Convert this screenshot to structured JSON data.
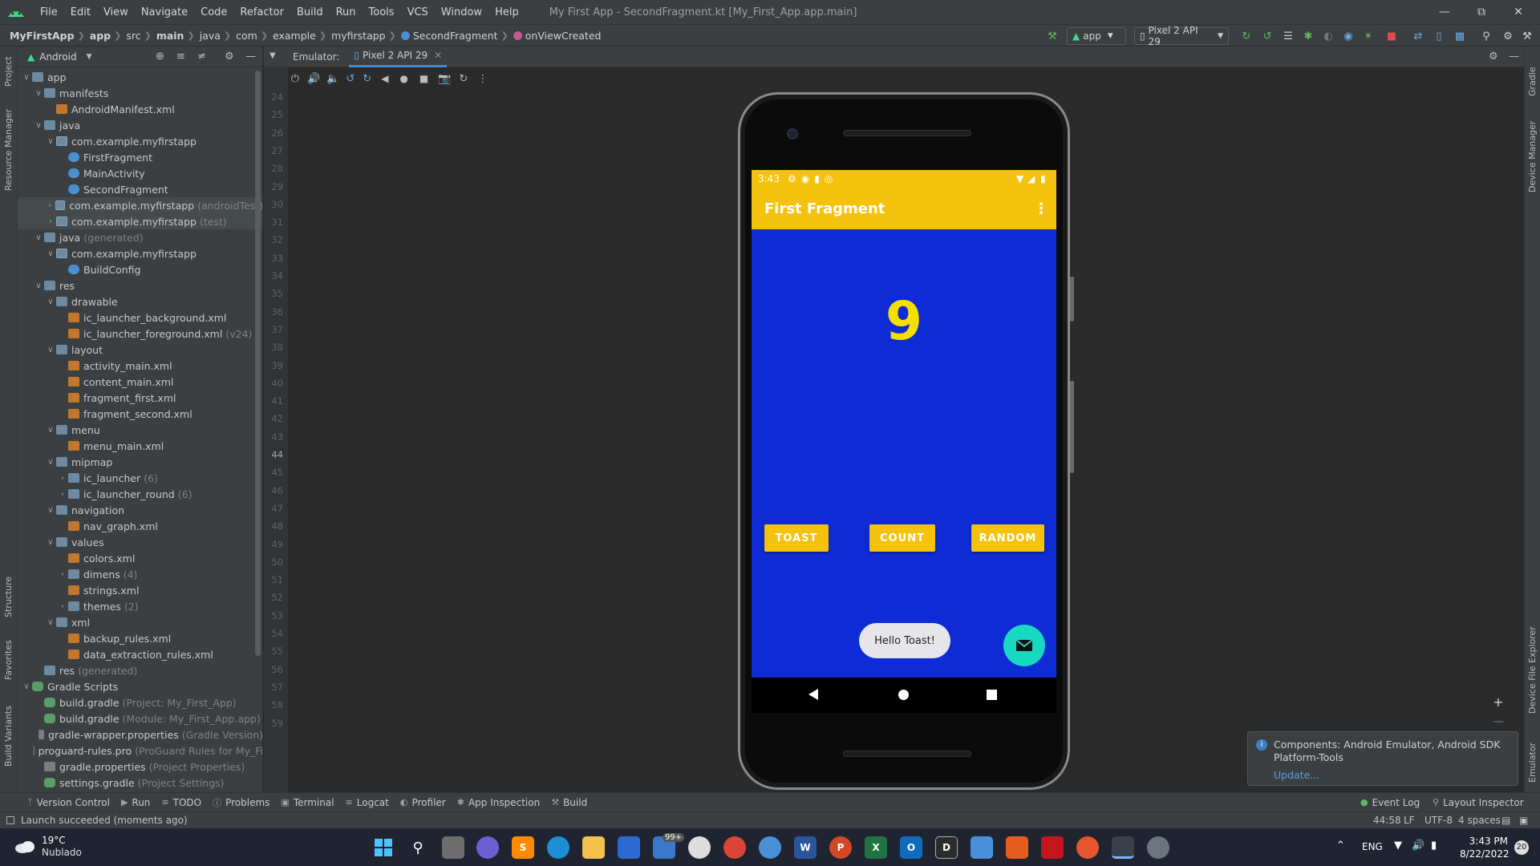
{
  "menubar": {
    "items": [
      "File",
      "Edit",
      "View",
      "Navigate",
      "Code",
      "Refactor",
      "Build",
      "Run",
      "Tools",
      "VCS",
      "Window",
      "Help"
    ],
    "title": "My First App - SecondFragment.kt [My_First_App.app.main]"
  },
  "breadcrumbs": {
    "items": [
      "MyFirstApp",
      "app",
      "src",
      "main",
      "java",
      "com",
      "example",
      "myfirstapp",
      "SecondFragment",
      "onViewCreated"
    ]
  },
  "toolbar": {
    "run_config": "app",
    "device": "Pixel 2 API 29"
  },
  "sidebar_left": {
    "tabs": [
      "Project",
      "Resource Manager",
      "Structure",
      "Favorites",
      "Build Variants"
    ]
  },
  "project": {
    "view": "Android",
    "tree": [
      {
        "label": "app",
        "sub": "",
        "icon": "folder",
        "arrow": "v"
      },
      {
        "label": "manifests",
        "sub": "",
        "icon": "folder",
        "arrow": "v"
      },
      {
        "label": "AndroidManifest.xml",
        "sub": "",
        "icon": "xml",
        "arrow": ""
      },
      {
        "label": "java",
        "sub": "",
        "icon": "folder",
        "arrow": "v"
      },
      {
        "label": "com.example.myfirstapp",
        "sub": "",
        "icon": "pkg",
        "arrow": "v"
      },
      {
        "label": "FirstFragment",
        "sub": "",
        "icon": "kt",
        "arrow": ""
      },
      {
        "label": "MainActivity",
        "sub": "",
        "icon": "kt",
        "arrow": ""
      },
      {
        "label": "SecondFragment",
        "sub": "",
        "icon": "kt",
        "arrow": ""
      },
      {
        "label": "com.example.myfirstapp",
        "sub": "(androidTest)",
        "icon": "pkg",
        "arrow": ">"
      },
      {
        "label": "com.example.myfirstapp",
        "sub": "(test)",
        "icon": "pkg",
        "arrow": ">"
      },
      {
        "label": "java",
        "sub": "(generated)",
        "icon": "folder",
        "arrow": "v"
      },
      {
        "label": "com.example.myfirstapp",
        "sub": "",
        "icon": "pkg",
        "arrow": "v"
      },
      {
        "label": "BuildConfig",
        "sub": "",
        "icon": "kt",
        "arrow": ""
      },
      {
        "label": "res",
        "sub": "",
        "icon": "folder",
        "arrow": "v"
      },
      {
        "label": "drawable",
        "sub": "",
        "icon": "folder",
        "arrow": "v"
      },
      {
        "label": "ic_launcher_background.xml",
        "sub": "",
        "icon": "xml",
        "arrow": ""
      },
      {
        "label": "ic_launcher_foreground.xml",
        "sub": "(v24)",
        "icon": "xml",
        "arrow": ""
      },
      {
        "label": "layout",
        "sub": "",
        "icon": "folder",
        "arrow": "v"
      },
      {
        "label": "activity_main.xml",
        "sub": "",
        "icon": "xml",
        "arrow": ""
      },
      {
        "label": "content_main.xml",
        "sub": "",
        "icon": "xml",
        "arrow": ""
      },
      {
        "label": "fragment_first.xml",
        "sub": "",
        "icon": "xml",
        "arrow": ""
      },
      {
        "label": "fragment_second.xml",
        "sub": "",
        "icon": "xml",
        "arrow": ""
      },
      {
        "label": "menu",
        "sub": "",
        "icon": "folder",
        "arrow": "v"
      },
      {
        "label": "menu_main.xml",
        "sub": "",
        "icon": "xml",
        "arrow": ""
      },
      {
        "label": "mipmap",
        "sub": "",
        "icon": "folder",
        "arrow": "v"
      },
      {
        "label": "ic_launcher",
        "sub": "(6)",
        "icon": "folder",
        "arrow": ">"
      },
      {
        "label": "ic_launcher_round",
        "sub": "(6)",
        "icon": "folder",
        "arrow": ">"
      },
      {
        "label": "navigation",
        "sub": "",
        "icon": "folder",
        "arrow": "v"
      },
      {
        "label": "nav_graph.xml",
        "sub": "",
        "icon": "xml",
        "arrow": ""
      },
      {
        "label": "values",
        "sub": "",
        "icon": "folder",
        "arrow": "v"
      },
      {
        "label": "colors.xml",
        "sub": "",
        "icon": "xml",
        "arrow": ""
      },
      {
        "label": "dimens",
        "sub": "(4)",
        "icon": "folder",
        "arrow": ">"
      },
      {
        "label": "strings.xml",
        "sub": "",
        "icon": "xml",
        "arrow": ""
      },
      {
        "label": "themes",
        "sub": "(2)",
        "icon": "folder",
        "arrow": ">"
      },
      {
        "label": "xml",
        "sub": "",
        "icon": "folder",
        "arrow": "v"
      },
      {
        "label": "backup_rules.xml",
        "sub": "",
        "icon": "xml",
        "arrow": ""
      },
      {
        "label": "data_extraction_rules.xml",
        "sub": "",
        "icon": "xml",
        "arrow": ""
      },
      {
        "label": "res",
        "sub": "(generated)",
        "icon": "folder",
        "arrow": ""
      },
      {
        "label": "Gradle Scripts",
        "sub": "",
        "icon": "gradle",
        "arrow": "v"
      },
      {
        "label": "build.gradle",
        "sub": "(Project: My_First_App)",
        "icon": "gradle",
        "arrow": ""
      },
      {
        "label": "build.gradle",
        "sub": "(Module: My_First_App.app)",
        "icon": "gradle",
        "arrow": ""
      },
      {
        "label": "gradle-wrapper.properties",
        "sub": "(Gradle Version)",
        "icon": "props",
        "arrow": ""
      },
      {
        "label": "proguard-rules.pro",
        "sub": "(ProGuard Rules for My_Fi",
        "icon": "props",
        "arrow": ""
      },
      {
        "label": "gradle.properties",
        "sub": "(Project Properties)",
        "icon": "props",
        "arrow": ""
      },
      {
        "label": "settings.gradle",
        "sub": "(Project Settings)",
        "icon": "gradle",
        "arrow": ""
      }
    ]
  },
  "emulator": {
    "label": "Emulator:",
    "tab": "Pixel 2 API 29",
    "line_numbers": [
      "24",
      "25",
      "26",
      "27",
      "28",
      "29",
      "30",
      "31",
      "32",
      "33",
      "34",
      "35",
      "36",
      "37",
      "38",
      "39",
      "40",
      "41",
      "42",
      "43",
      "44",
      "45",
      "46",
      "47",
      "48",
      "49",
      "50",
      "51",
      "52",
      "53",
      "54",
      "55",
      "56",
      "57",
      "58",
      "59"
    ]
  },
  "phone": {
    "status_time": "3:43",
    "app_title": "First Fragment",
    "count": "9",
    "buttons": {
      "toast": "TOAST",
      "count": "COUNT",
      "random": "RANDOM"
    },
    "toast_message": "Hello Toast!"
  },
  "sidebar_right": {
    "tabs": [
      "Gradle",
      "Device Manager",
      "Device File Explorer",
      "Emulator"
    ]
  },
  "notification": {
    "text": "Components: Android Emulator, Android SDK Platform-Tools",
    "link": "Update..."
  },
  "bottom_tools": {
    "items": [
      "Version Control",
      "Run",
      "TODO",
      "Problems",
      "Terminal",
      "Logcat",
      "Profiler",
      "App Inspection",
      "Build"
    ],
    "right": [
      "Event Log",
      "Layout Inspector"
    ]
  },
  "status": {
    "message": "Launch succeeded (moments ago)",
    "position": "44:58",
    "line_sep": "LF",
    "encoding": "UTF-8",
    "indent": "4 spaces"
  },
  "taskbar": {
    "weather_temp": "19°C",
    "weather_desc": "Nublado",
    "badge": "99+",
    "lang": "ENG",
    "time": "3:43 PM",
    "date": "8/22/2022",
    "notif_count": "20"
  },
  "colors": {
    "accent_yellow": "#f4c20d",
    "screen_blue": "#0f2bd6",
    "fab_teal": "#18d8c0"
  }
}
